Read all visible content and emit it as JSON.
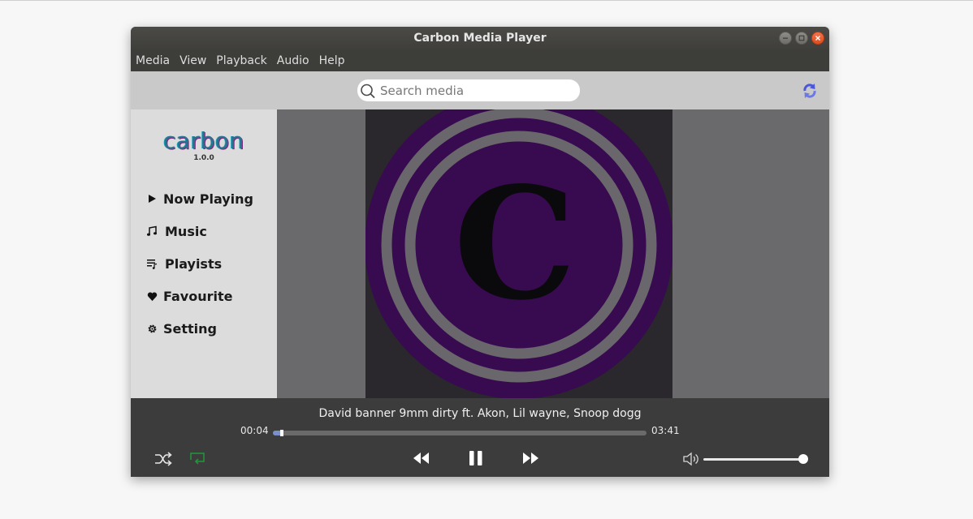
{
  "window": {
    "title": "Carbon Media Player"
  },
  "menubar": {
    "items": [
      "Media",
      "View",
      "Playback",
      "Audio",
      "Help"
    ]
  },
  "search": {
    "placeholder": "Search media",
    "value": ""
  },
  "sidebar": {
    "logo": "carbon",
    "version": "1.0.0",
    "items": [
      {
        "label": "Now Playing",
        "icon": "play-icon"
      },
      {
        "label": "Music",
        "icon": "music-note-icon"
      },
      {
        "label": "Playists",
        "icon": "playlist-icon"
      },
      {
        "label": "Favourite",
        "icon": "heart-icon"
      },
      {
        "label": "Setting",
        "icon": "gear-icon"
      }
    ]
  },
  "artwork": {
    "letter": "C"
  },
  "player": {
    "track_title": "David banner 9mm dirty ft. Akon, Lil wayne, Snoop dogg",
    "elapsed": "00:04",
    "duration": "03:41",
    "progress_fraction": 0.018,
    "volume_fraction": 1.0
  },
  "colors": {
    "accent": "#7b8fc6",
    "repeat_active": "#1f9a3a",
    "artwork_circle": "#380a50",
    "artwork_ring": "#69676b",
    "close_button": "#e9582b"
  }
}
